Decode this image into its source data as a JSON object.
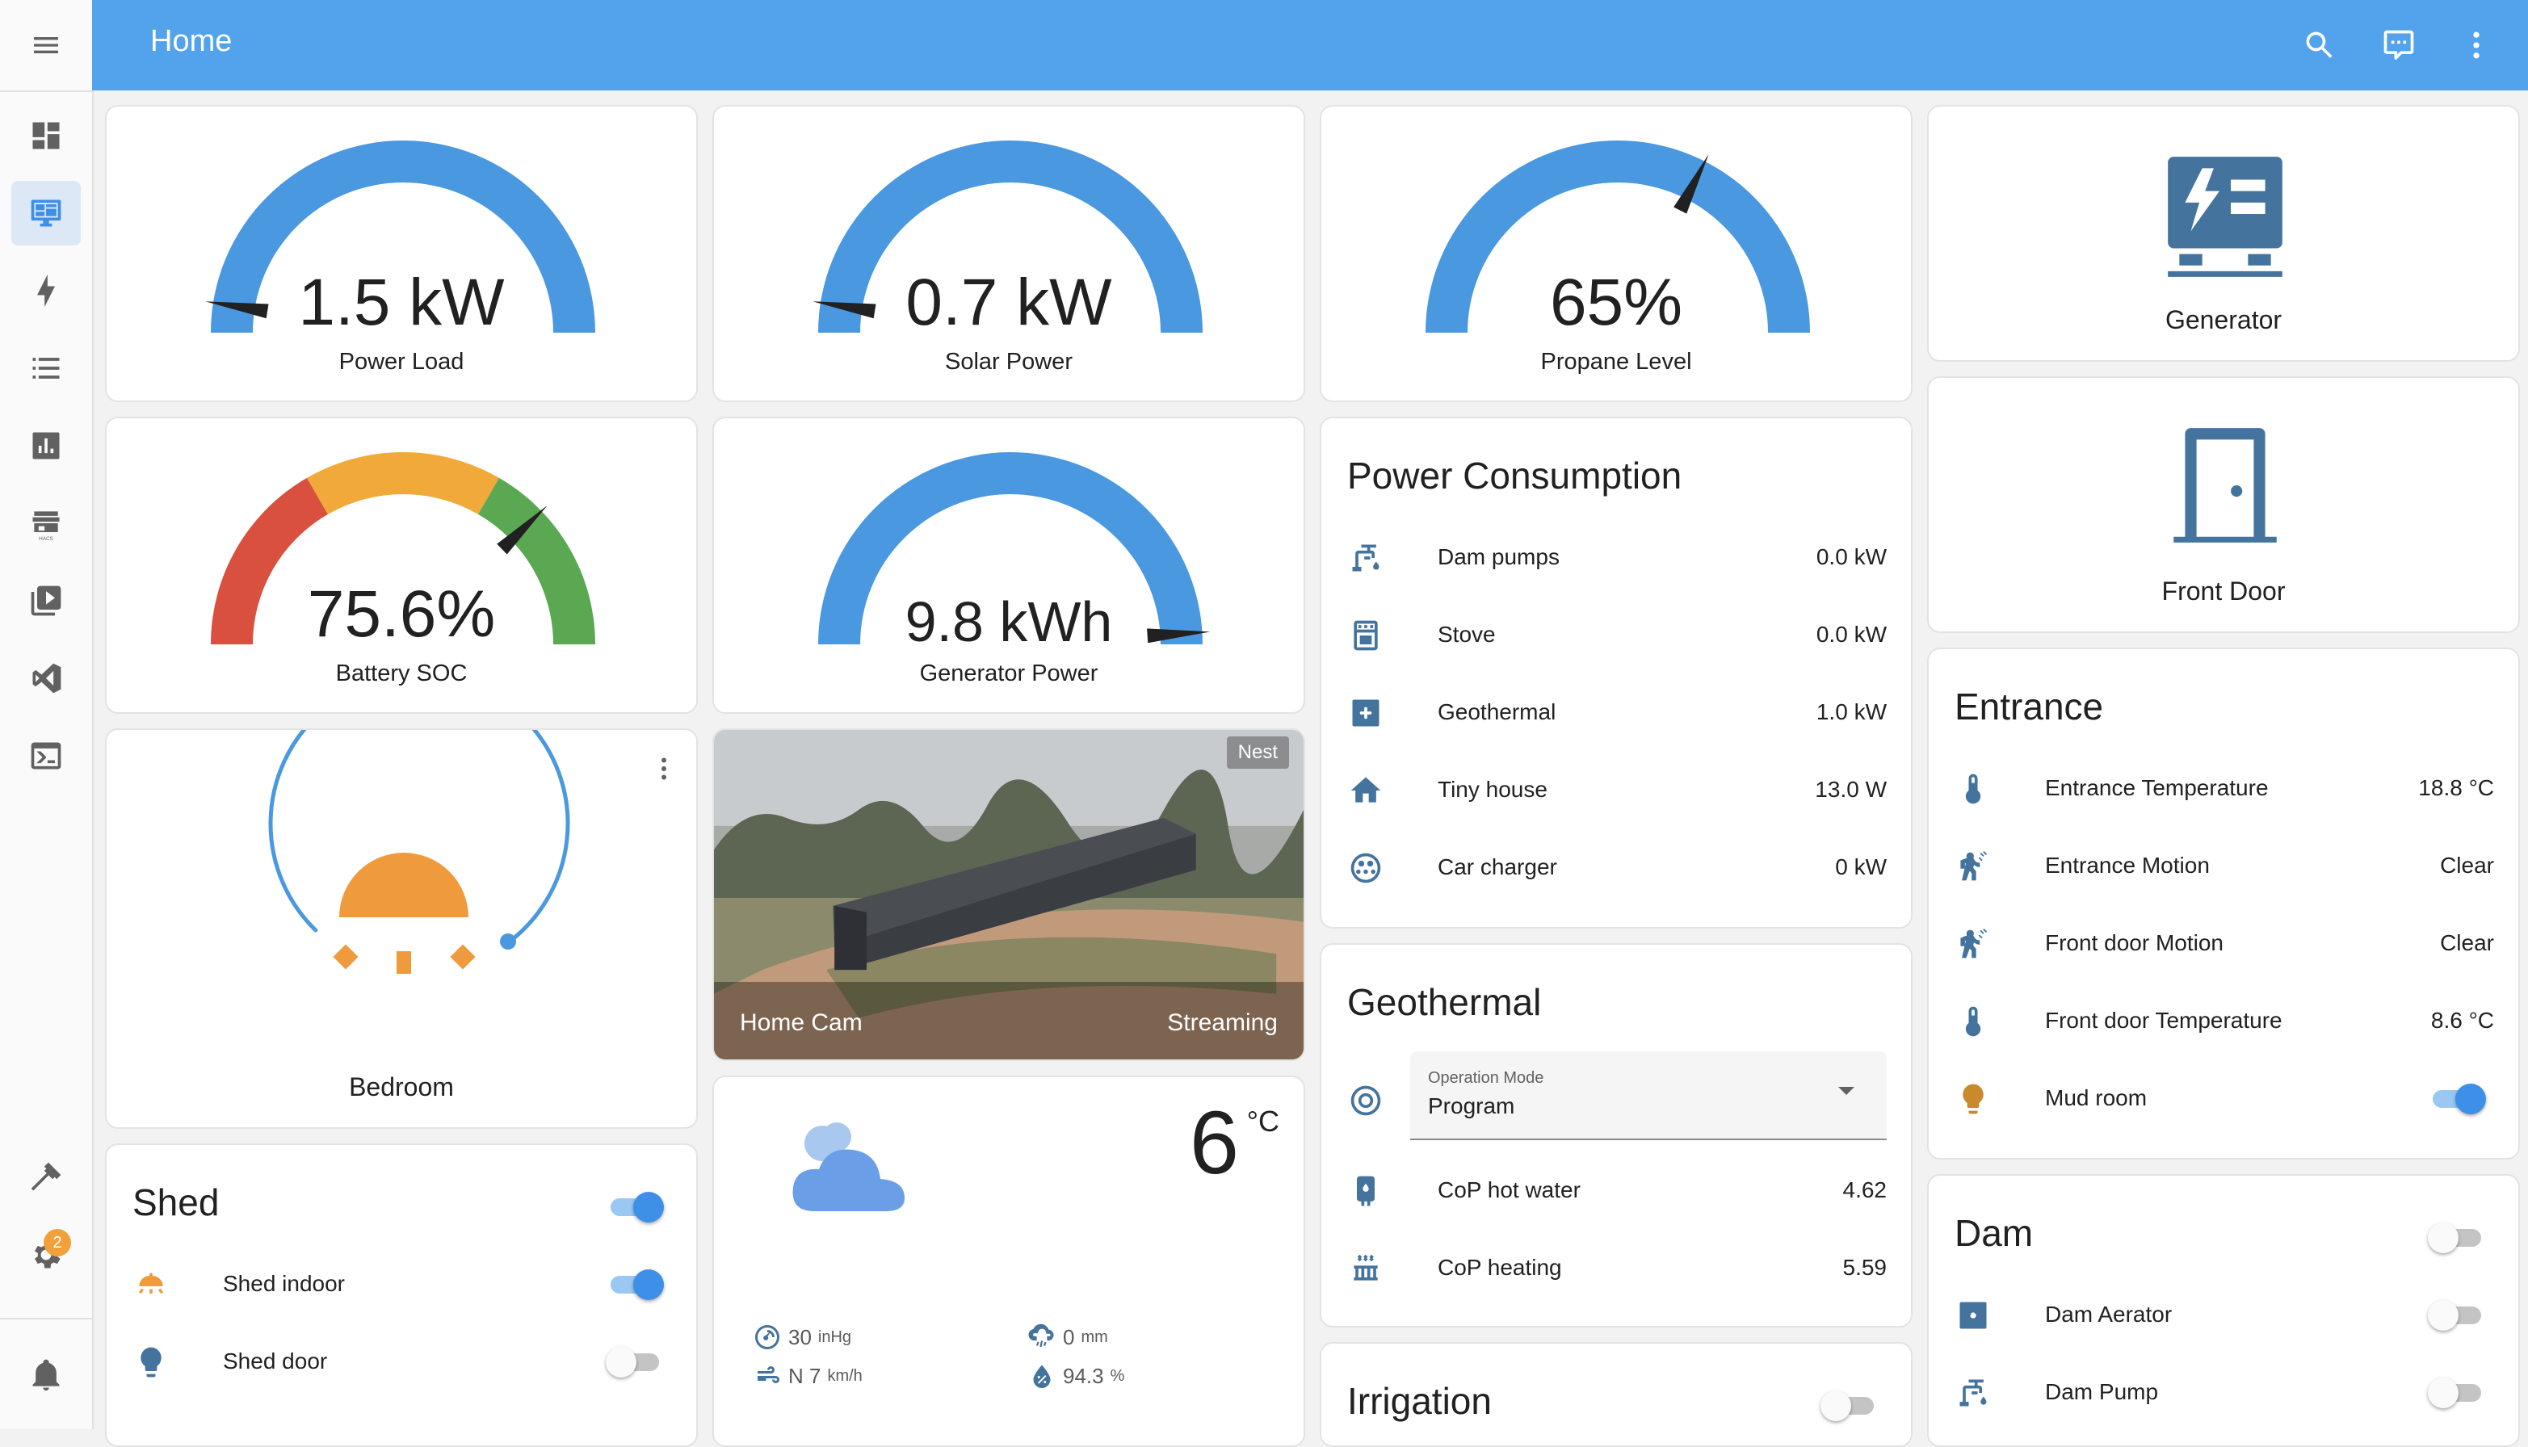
{
  "header": {
    "title": "Home"
  },
  "sidebar": {
    "items": [
      {
        "name": "Overview",
        "icon": "view-dashboard-icon"
      },
      {
        "name": "Home",
        "icon": "monitor-dashboard-icon",
        "active": true
      },
      {
        "name": "Energy",
        "icon": "lightning-bolt-icon"
      },
      {
        "name": "Logbook",
        "icon": "format-list-bulleted-icon"
      },
      {
        "name": "History",
        "icon": "chart-box-icon"
      },
      {
        "name": "HACS",
        "icon": "hacs-store-icon",
        "caption": "HACS"
      },
      {
        "name": "Media",
        "icon": "play-box-icon"
      },
      {
        "name": "Studio Code Server",
        "icon": "vscode-icon"
      },
      {
        "name": "Terminal",
        "icon": "console-icon"
      },
      {
        "name": "Developer tools",
        "icon": "hammer-icon"
      },
      {
        "name": "Settings",
        "icon": "cog-icon",
        "badge": "2"
      },
      {
        "name": "Notifications",
        "icon": "bell-icon"
      }
    ]
  },
  "gauges": [
    {
      "value": "1.5 kW",
      "name": "Power Load",
      "fraction": 0.05,
      "color": "#4a98e0"
    },
    {
      "value": "0.7 kW",
      "name": "Solar Power",
      "fraction": 0.05,
      "color": "#4a98e0"
    },
    {
      "value": "65%",
      "name": "Propane Level",
      "fraction": 0.65,
      "color": "#4a98e0"
    },
    {
      "value": "75.6%",
      "name": "Battery SOC",
      "fraction": 0.756,
      "segments": [
        "#d9503f",
        "#f1a93a",
        "#5ba853"
      ]
    },
    {
      "value": "9.8 kWh",
      "name": "Generator Power",
      "fraction": 0.98,
      "color": "#4a98e0"
    }
  ],
  "thermostat": {
    "name": "Bedroom"
  },
  "camera": {
    "name": "Home Cam",
    "state": "Streaming",
    "tag": "Nest"
  },
  "weather": {
    "temperature": "6",
    "unit": "°C",
    "pressure": "30",
    "pressure_unit": "inHg",
    "precipitation": "0",
    "precipitation_unit": "mm",
    "wind": "N 7",
    "wind_unit": "km/h",
    "humidity": "94.3",
    "humidity_unit": "%"
  },
  "shed": {
    "title": "Shed",
    "toggle_on": true,
    "rows": [
      {
        "name": "Shed indoor",
        "icon": "ceiling-light-icon",
        "on": true
      },
      {
        "name": "Shed door",
        "icon": "lightbulb-icon",
        "on": false
      }
    ]
  },
  "power_consumption": {
    "title": "Power Consumption",
    "rows": [
      {
        "name": "Dam pumps",
        "value": "0.0 kW",
        "icon": "water-pump-icon"
      },
      {
        "name": "Stove",
        "value": "0.0 kW",
        "icon": "stove-icon"
      },
      {
        "name": "Geothermal",
        "value": "1.0 kW",
        "icon": "heat-pump-icon"
      },
      {
        "name": "Tiny house",
        "value": "13.0 W",
        "icon": "home-icon"
      },
      {
        "name": "Car charger",
        "value": "0 kW",
        "icon": "ev-plug-icon"
      }
    ]
  },
  "geothermal": {
    "title": "Geothermal",
    "select_label": "Operation Mode",
    "select_value": "Program",
    "rows": [
      {
        "name": "CoP hot water",
        "value": "4.62",
        "icon": "water-boiler-icon"
      },
      {
        "name": "CoP heating",
        "value": "5.59",
        "icon": "radiator-icon"
      }
    ]
  },
  "irrigation": {
    "title": "Irrigation",
    "toggle_on": false
  },
  "generator": {
    "name": "Generator"
  },
  "front_door": {
    "name": "Front Door"
  },
  "entrance": {
    "title": "Entrance",
    "rows": [
      {
        "name": "Entrance Temperature",
        "value": "18.8 °C",
        "icon": "thermometer-icon"
      },
      {
        "name": "Entrance Motion",
        "value": "Clear",
        "icon": "motion-sensor-icon"
      },
      {
        "name": "Front door Motion",
        "value": "Clear",
        "icon": "motion-sensor-icon"
      },
      {
        "name": "Front door Temperature",
        "value": "8.6 °C",
        "icon": "thermometer-icon"
      },
      {
        "name": "Mud room",
        "icon": "lightbulb-icon",
        "on": true
      }
    ]
  },
  "dam": {
    "title": "Dam",
    "toggle_on": false,
    "rows": [
      {
        "name": "Dam Aerator",
        "icon": "fan-icon",
        "on": false
      },
      {
        "name": "Dam Pump",
        "icon": "water-pump-icon",
        "on": false
      }
    ]
  },
  "colors": {
    "header": "#53a3ec",
    "accent": "#3d8fe8",
    "icon": "#44739e",
    "gauge": "#4a98e0",
    "warm": "#f09a3e"
  }
}
